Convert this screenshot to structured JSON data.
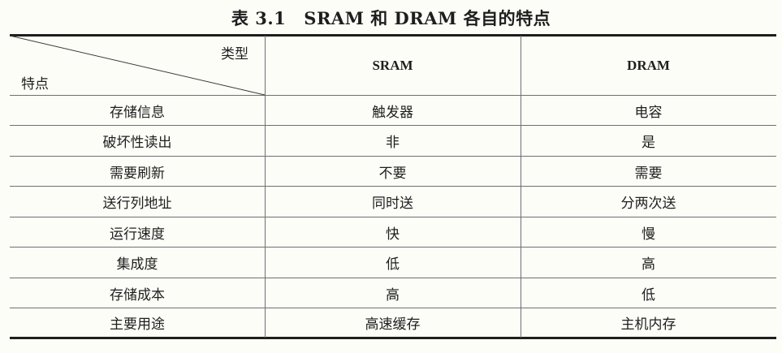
{
  "caption": {
    "label": "表 3.1",
    "text": "SRAM 和 DRAM 各自的特点"
  },
  "table": {
    "corner": {
      "top": "类型",
      "bottom": "特点"
    },
    "columns": [
      "SRAM",
      "DRAM"
    ],
    "rows": [
      {
        "feature": "存储信息",
        "sram": "触发器",
        "dram": "电容"
      },
      {
        "feature": "破坏性读出",
        "sram": "非",
        "dram": "是"
      },
      {
        "feature": "需要刷新",
        "sram": "不要",
        "dram": "需要"
      },
      {
        "feature": "送行列地址",
        "sram": "同时送",
        "dram": "分两次送"
      },
      {
        "feature": "运行速度",
        "sram": "快",
        "dram": "慢"
      },
      {
        "feature": "集成度",
        "sram": "低",
        "dram": "高"
      },
      {
        "feature": "存储成本",
        "sram": "高",
        "dram": "低"
      },
      {
        "feature": "主要用途",
        "sram": "高速缓存",
        "dram": "主机内存"
      }
    ]
  }
}
